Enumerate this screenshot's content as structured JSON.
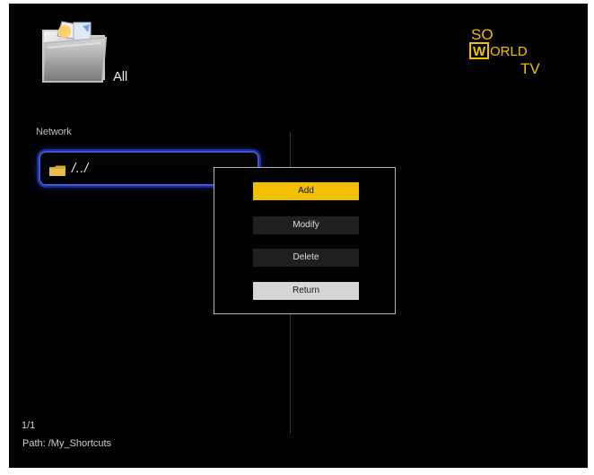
{
  "header": {
    "category": "All"
  },
  "brand": {
    "line1": "SO",
    "line2_badge": "W",
    "line2_rest": "ORLD",
    "line3": "TV",
    "accent": "#f0c000"
  },
  "browser": {
    "section_title": "Network",
    "items": [
      {
        "label": "/../"
      }
    ]
  },
  "dialog": {
    "buttons": {
      "add": "Add",
      "modify": "Modify",
      "delete": "Delete",
      "return": "Return"
    },
    "selected": "Add"
  },
  "footer": {
    "page": "1/1",
    "path": "Path: /My_Shortcuts"
  }
}
